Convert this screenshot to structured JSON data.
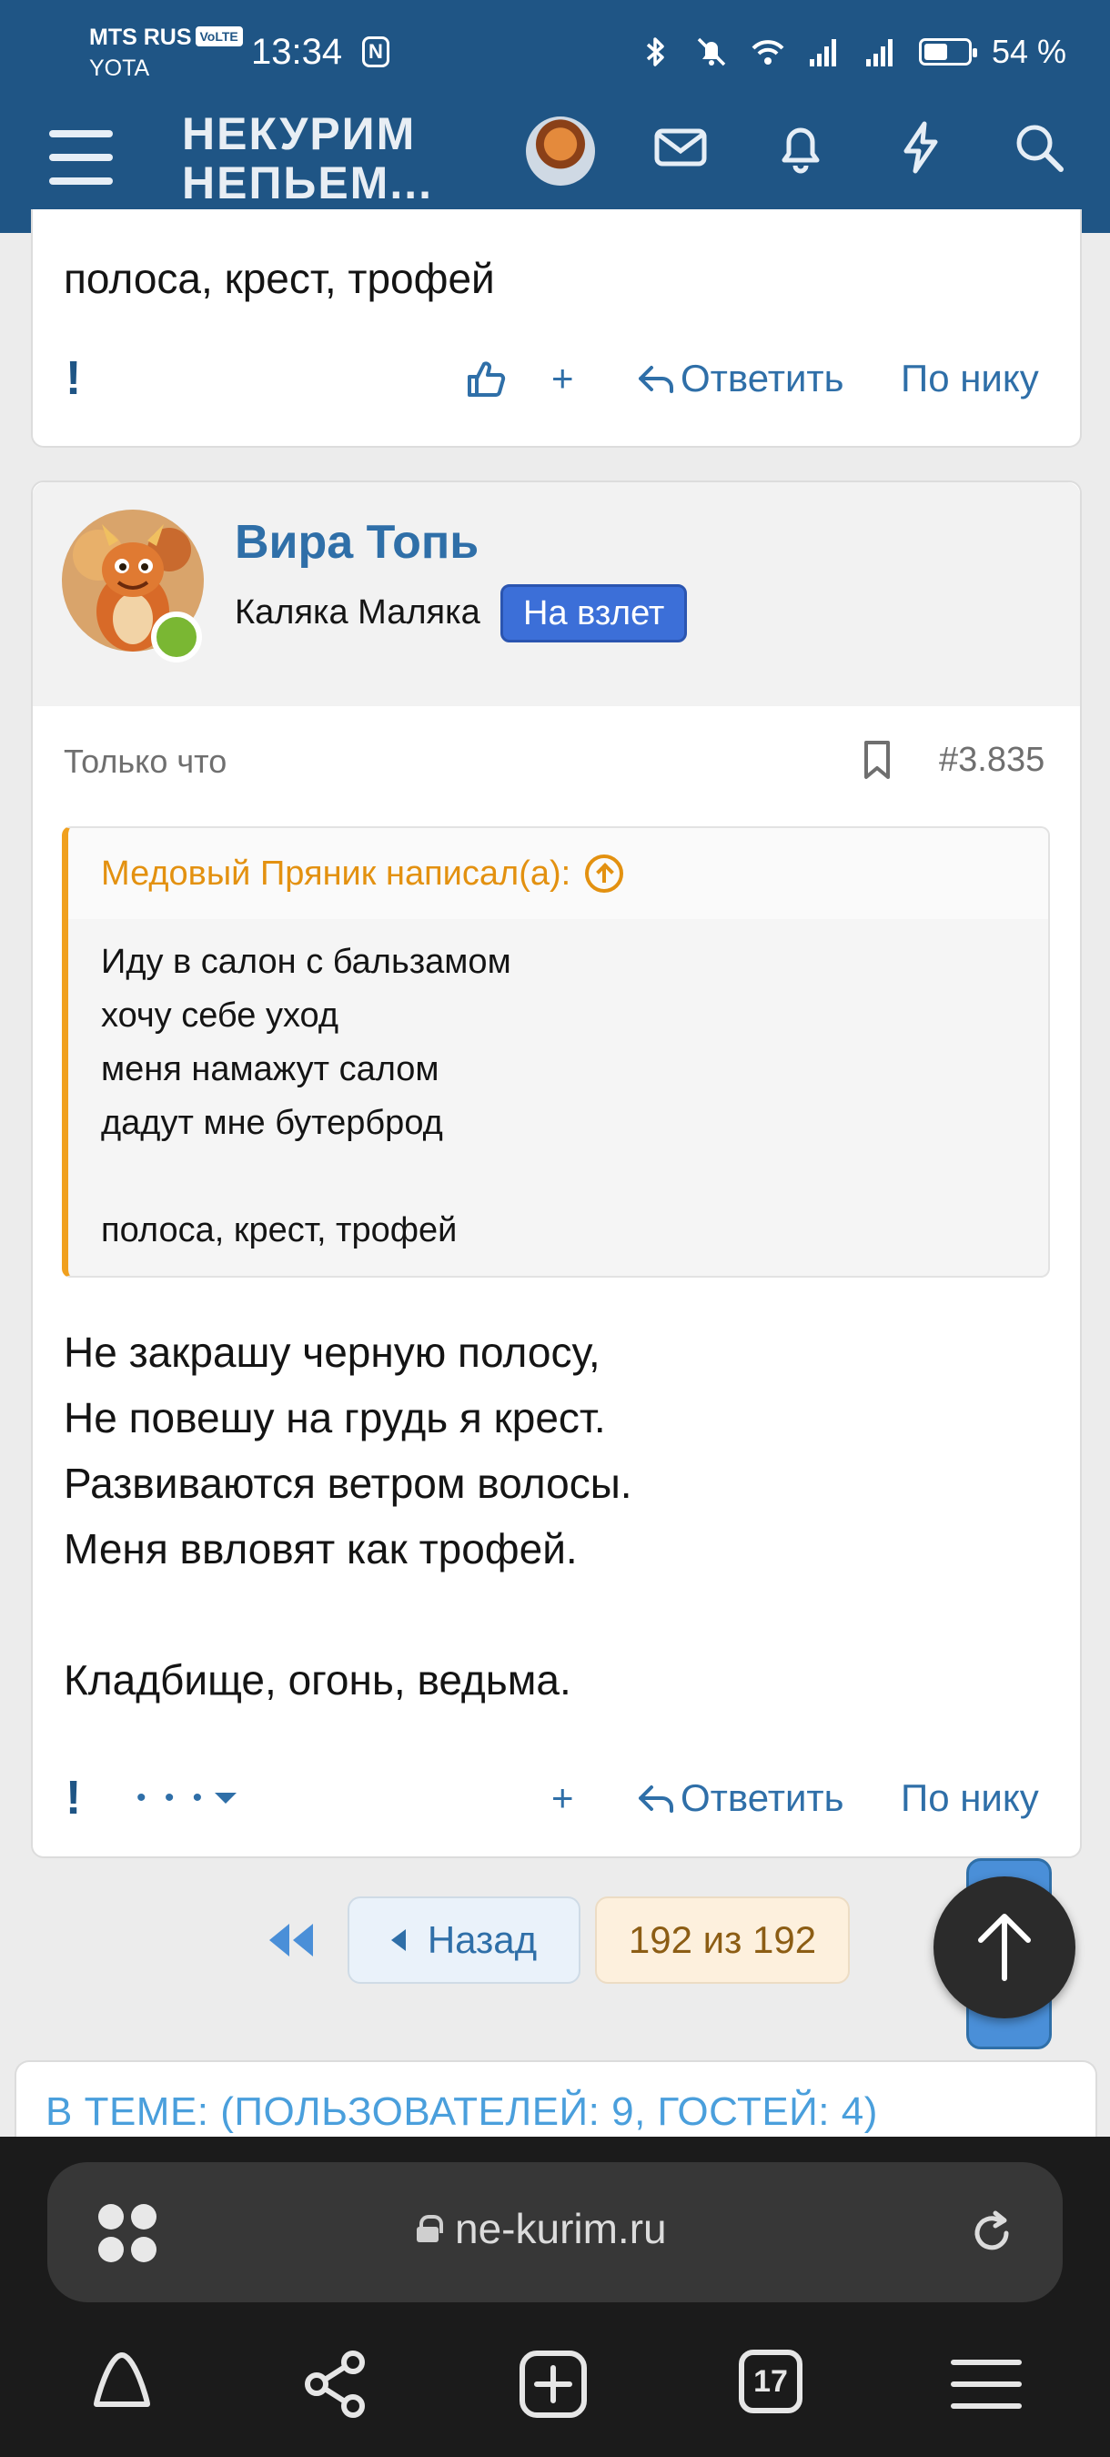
{
  "status_bar": {
    "carrier_1": "MTS RUS",
    "volte": "VoLTE",
    "carrier_2": "YOTA",
    "time": "13:34",
    "nfc": "N",
    "battery_percent": "54 %",
    "battery_level": 0.54
  },
  "header": {
    "logo_line1": "НЕКУРИМ",
    "logo_line2": "НЕПЬЕМ..."
  },
  "post_prev": {
    "text": "полоса, крест, трофей",
    "reply_label": "Ответить",
    "by_nick_label": "По нику",
    "plus_label": "+",
    "report_label": "!"
  },
  "post": {
    "username": "Вира Топь",
    "user_title": "Каляка Маляка",
    "banner": "На взлет",
    "time": "Только что",
    "number": "#3.835",
    "quote": {
      "author": "Медовый Пряник написал(а):",
      "text": "Иду в салон с бальзамом\nхочу себе уход\nменя намажут салом\nдадут мне бутерброд\n\nполоса, крест, трофей"
    },
    "body": "Не закрашу черную полосу,\nНе повешу на грудь я крест.\nРазвиваются ветром волосы.\nМеня ввловят как трофей.\n\nКладбище, огонь, ведьма.",
    "report_label": "!",
    "more_label": "• • •",
    "plus_label": "+",
    "reply_label": "Ответить",
    "by_nick_label": "По нику"
  },
  "pagination": {
    "back_label": "Назад",
    "current": "192 из 192"
  },
  "members": {
    "title": "В ТЕМЕ: (ПОЛЬЗОВАТЕЛЕЙ: 9, ГОСТЕЙ: 4)"
  },
  "browser": {
    "url": "ne-kurim.ru",
    "tabs_count": "17"
  },
  "colors": {
    "header_bg": "#1f5585",
    "link": "#2f6fa8",
    "quote_accent": "#e39110",
    "banner": "#3c6fd8",
    "online": "#7ab733"
  }
}
